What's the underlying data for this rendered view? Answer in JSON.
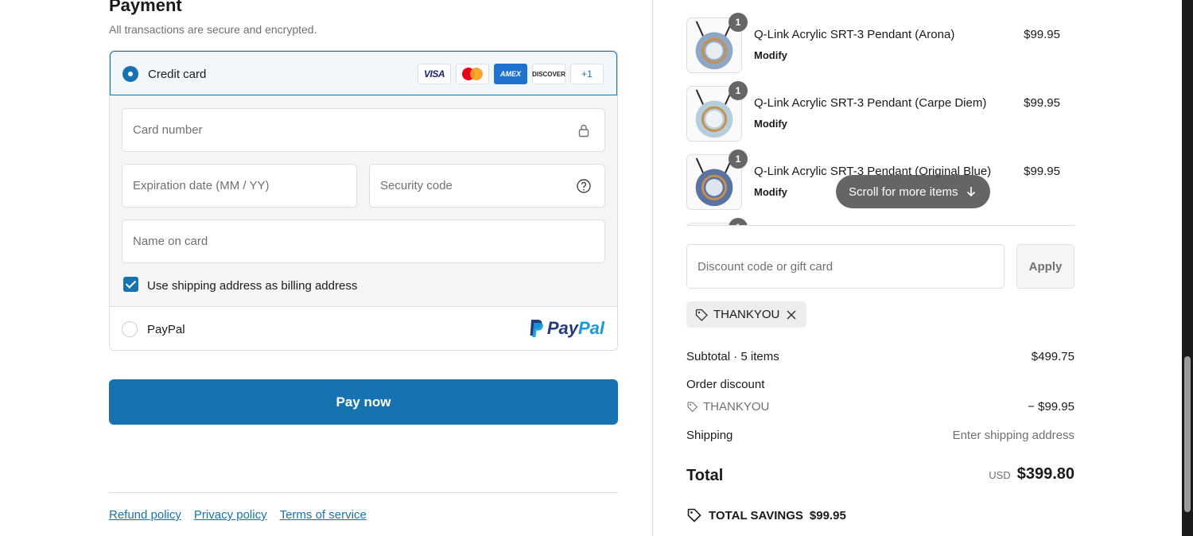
{
  "payment": {
    "title": "Payment",
    "subtitle": "All transactions are secure and encrypted.",
    "credit_card_label": "Credit card",
    "card_brands": [
      "VISA",
      "Mastercard",
      "AMEX",
      "DISCOVER",
      "+1"
    ],
    "card_number_placeholder": "Card number",
    "expiration_placeholder": "Expiration date (MM / YY)",
    "security_code_placeholder": "Security code",
    "name_on_card_placeholder": "Name on card",
    "billing_checkbox_label": "Use shipping address as billing address",
    "billing_checked": true,
    "paypal_label": "PayPal",
    "paypal_logo_text_1": "Pay",
    "paypal_logo_text_2": "Pal",
    "pay_now_label": "Pay now"
  },
  "footer": {
    "links": [
      "Refund policy",
      "Privacy policy",
      "Terms of service"
    ]
  },
  "cart": {
    "items": [
      {
        "name": "Q-Link Acrylic SRT-3 Pendant (Arona)",
        "price": "$99.95",
        "qty": "1",
        "modify": "Modify",
        "color": "#8fa6c4"
      },
      {
        "name": "Q-Link Acrylic SRT-3 Pendant (Carpe Diem)",
        "price": "$99.95",
        "qty": "1",
        "modify": "Modify",
        "color": "#b6cddc"
      },
      {
        "name": "Q-Link Acrylic SRT-3 Pendant (Original Blue)",
        "price": "$99.95",
        "qty": "1",
        "modify": "Modify",
        "color": "#5a73a0"
      },
      {
        "name": "",
        "price": "",
        "qty": "1",
        "modify": "",
        "color": "#cccccc"
      }
    ],
    "scroll_hint": "Scroll for more items"
  },
  "discount": {
    "placeholder": "Discount code or gift card",
    "apply_label": "Apply",
    "applied_code": "THANKYOU"
  },
  "summary": {
    "subtotal_label": "Subtotal · 5 items",
    "subtotal_value": "$499.75",
    "order_discount_label": "Order discount",
    "discount_code": "THANKYOU",
    "discount_value": "− $99.95",
    "shipping_label": "Shipping",
    "shipping_value": "Enter shipping address",
    "total_label": "Total",
    "currency": "USD",
    "total_value": "$399.80",
    "savings_label": "TOTAL SAVINGS",
    "savings_value": "$99.95"
  },
  "colors": {
    "accent": "#1773b0",
    "muted": "#707070",
    "border": "#dedede"
  }
}
